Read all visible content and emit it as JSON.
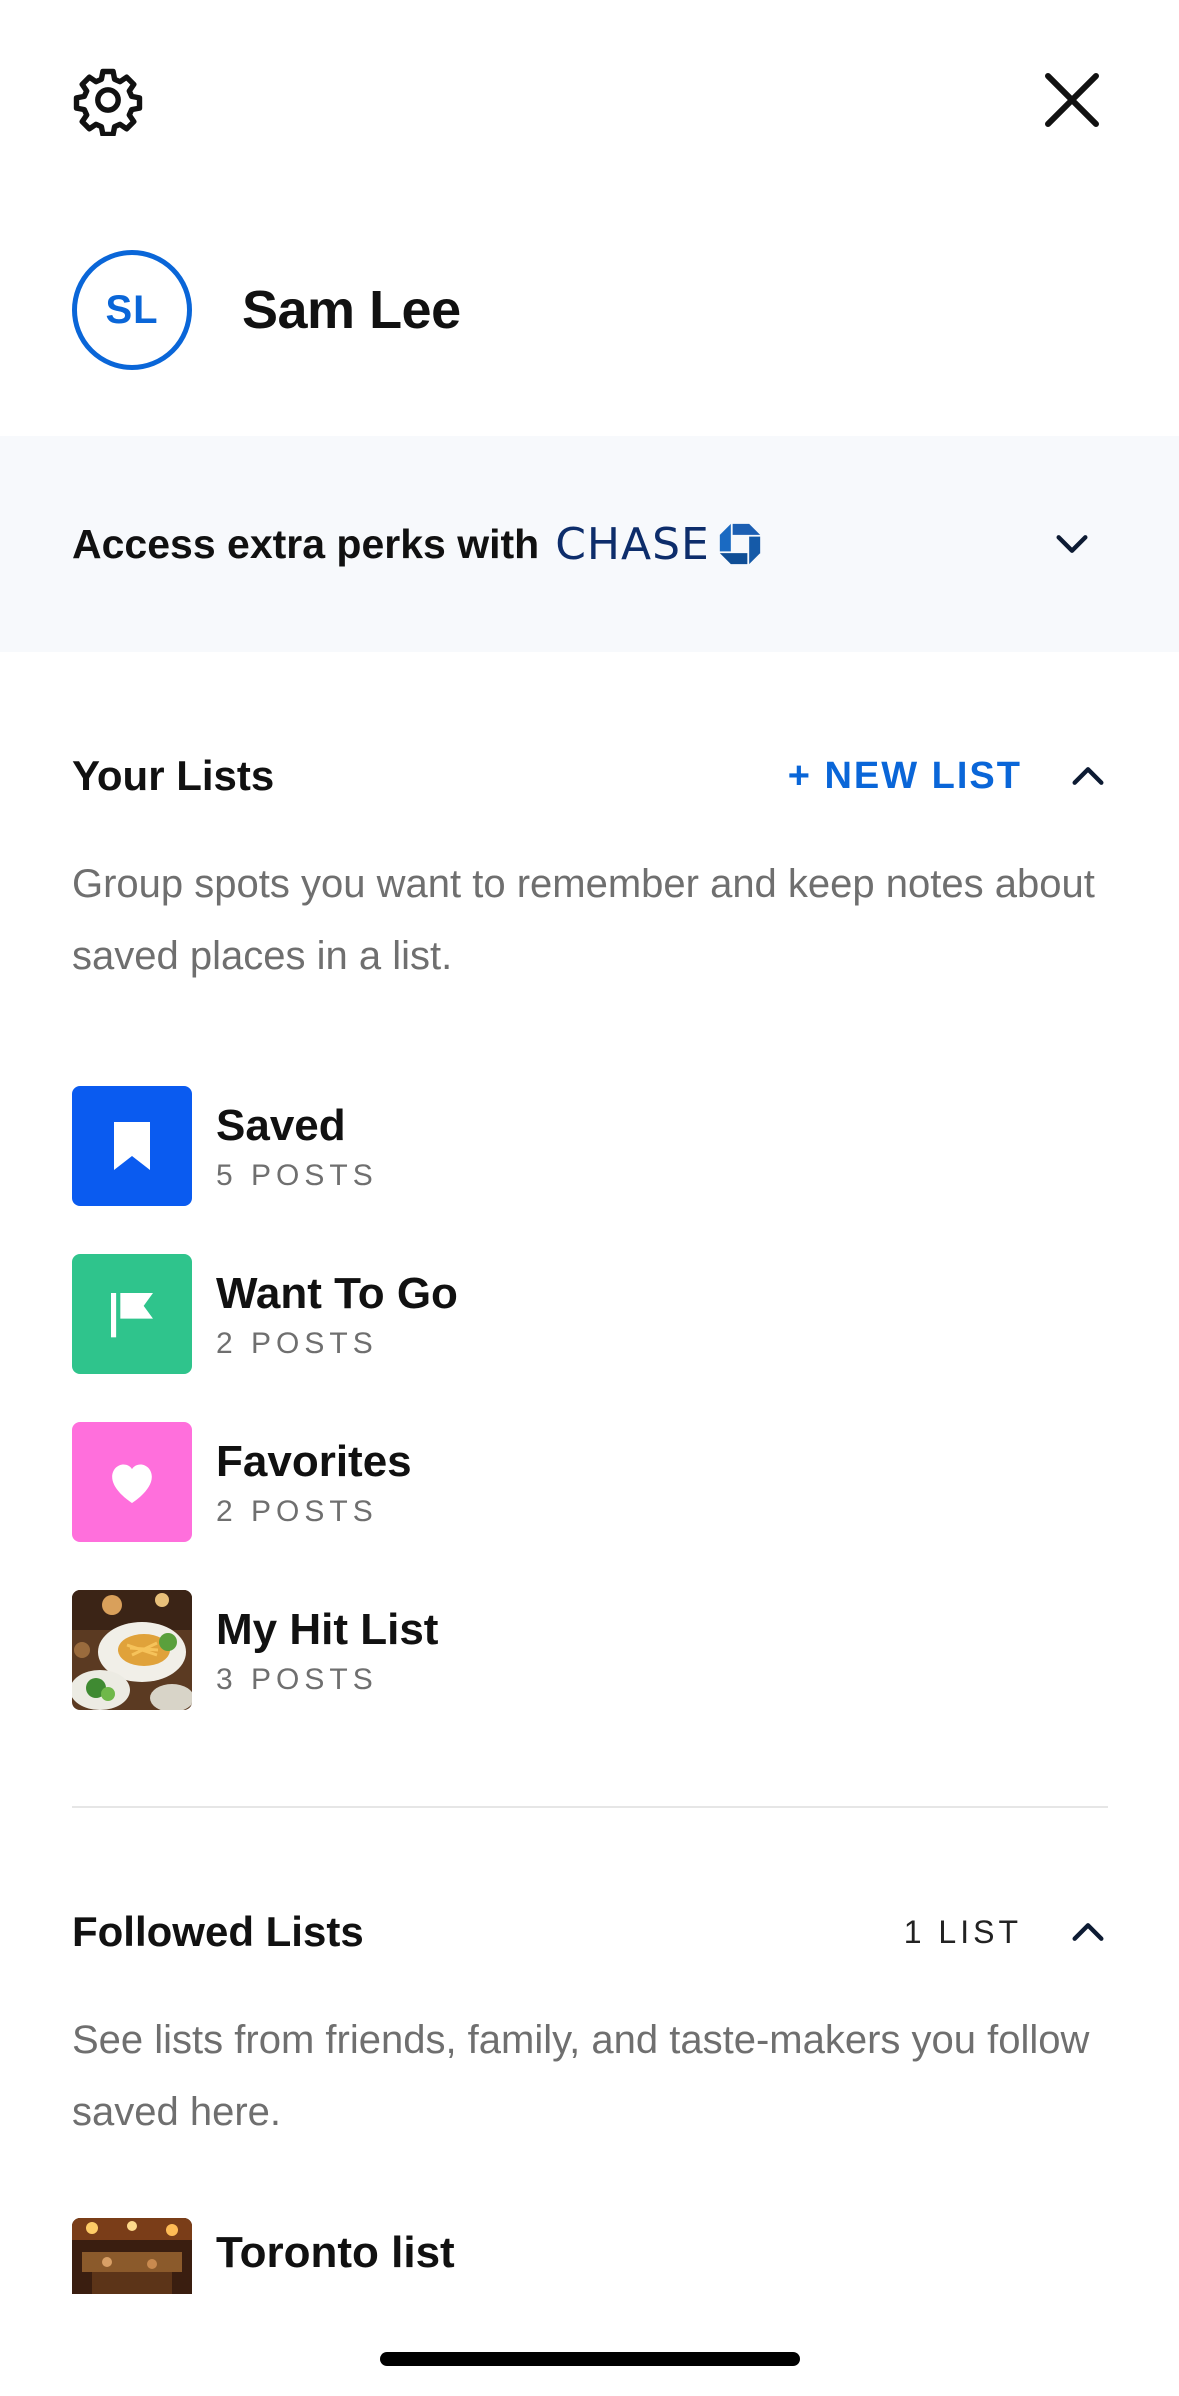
{
  "topbar": {
    "settings_icon": "gear-icon",
    "close_icon": "close-icon"
  },
  "profile": {
    "initials": "SL",
    "name": "Sam Lee"
  },
  "perks": {
    "label": "Access extra perks with",
    "brand": "CHASE",
    "icon": "chevron-down-icon"
  },
  "your_lists": {
    "title": "Your Lists",
    "new_list_label": "+ NEW LIST",
    "description": "Group spots you want to remember and keep notes about saved places in a list.",
    "items": [
      {
        "name": "Saved",
        "count": "5 POSTS",
        "icon": "bookmark-icon",
        "color": "#0a5bf0"
      },
      {
        "name": "Want To Go",
        "count": "2 POSTS",
        "icon": "flag-icon",
        "color": "#2fc48c"
      },
      {
        "name": "Favorites",
        "count": "2 POSTS",
        "icon": "heart-icon",
        "color": "#ff6fdc"
      },
      {
        "name": "My Hit List",
        "count": "3 POSTS",
        "icon": "photo-thumbnail"
      }
    ]
  },
  "followed_lists": {
    "title": "Followed Lists",
    "count_label": "1 LIST",
    "description": "See lists from friends, family, and taste-makers you follow saved here.",
    "items": [
      {
        "name": "Toronto list",
        "icon": "photo-thumbnail"
      }
    ]
  },
  "colors": {
    "accent": "#0a66d8",
    "perks_bg": "#f7f9fc",
    "chase_navy": "#0d2d6b"
  }
}
